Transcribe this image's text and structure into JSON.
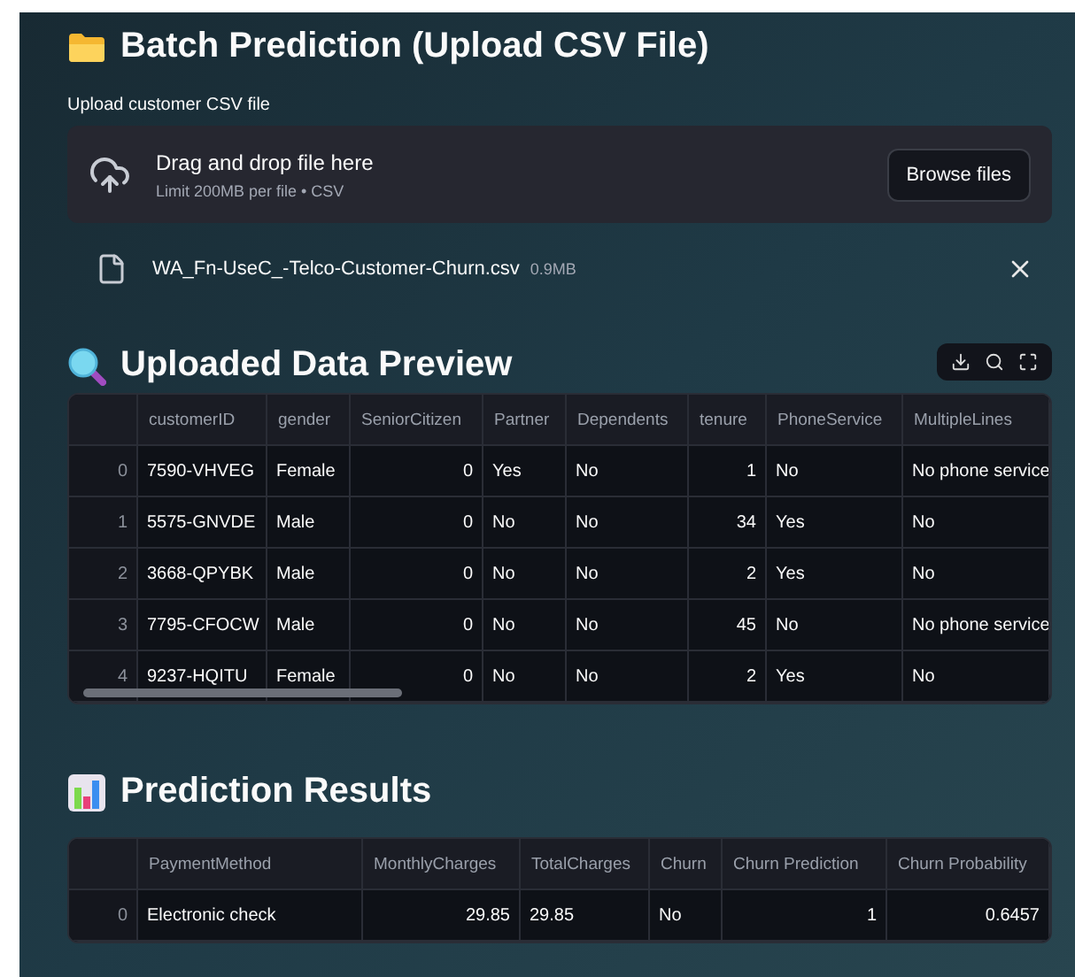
{
  "batch": {
    "title": "Batch Prediction (Upload CSV File)",
    "label": "Upload customer CSV file",
    "prompt": "Drag and drop file here",
    "limit": "Limit 200MB per file • CSV",
    "button": "Browse files"
  },
  "file": {
    "name": "WA_Fn-UseC_-Telco-Customer-Churn.csv",
    "size": "0.9MB"
  },
  "preview": {
    "title": "Uploaded Data Preview",
    "columns": [
      {
        "label": "customerID",
        "numeric": false
      },
      {
        "label": "gender",
        "numeric": false
      },
      {
        "label": "SeniorCitizen",
        "numeric": true
      },
      {
        "label": "Partner",
        "numeric": false
      },
      {
        "label": "Dependents",
        "numeric": false
      },
      {
        "label": "tenure",
        "numeric": true
      },
      {
        "label": "PhoneService",
        "numeric": false
      },
      {
        "label": "MultipleLines",
        "numeric": false
      }
    ],
    "rows": [
      {
        "index": "0",
        "cells": [
          "7590-VHVEG",
          "Female",
          "0",
          "Yes",
          "No",
          "1",
          "No",
          "No phone service"
        ]
      },
      {
        "index": "1",
        "cells": [
          "5575-GNVDE",
          "Male",
          "0",
          "No",
          "No",
          "34",
          "Yes",
          "No"
        ]
      },
      {
        "index": "2",
        "cells": [
          "3668-QPYBK",
          "Male",
          "0",
          "No",
          "No",
          "2",
          "Yes",
          "No"
        ]
      },
      {
        "index": "3",
        "cells": [
          "7795-CFOCW",
          "Male",
          "0",
          "No",
          "No",
          "45",
          "No",
          "No phone service"
        ]
      },
      {
        "index": "4",
        "cells": [
          "9237-HQITU",
          "Female",
          "0",
          "No",
          "No",
          "2",
          "Yes",
          "No"
        ]
      }
    ]
  },
  "results": {
    "title": "Prediction Results",
    "columns": [
      {
        "label": "PaymentMethod",
        "numeric": false
      },
      {
        "label": "MonthlyCharges",
        "numeric": true
      },
      {
        "label": "TotalCharges",
        "numeric": false
      },
      {
        "label": "Churn",
        "numeric": false
      },
      {
        "label": "Churn Prediction",
        "numeric": true
      },
      {
        "label": "Churn Probability",
        "numeric": true
      }
    ],
    "rows": [
      {
        "index": "0",
        "cells": [
          "Electronic check",
          "29.85",
          "29.85",
          "No",
          "1",
          "0.6457"
        ]
      }
    ]
  }
}
